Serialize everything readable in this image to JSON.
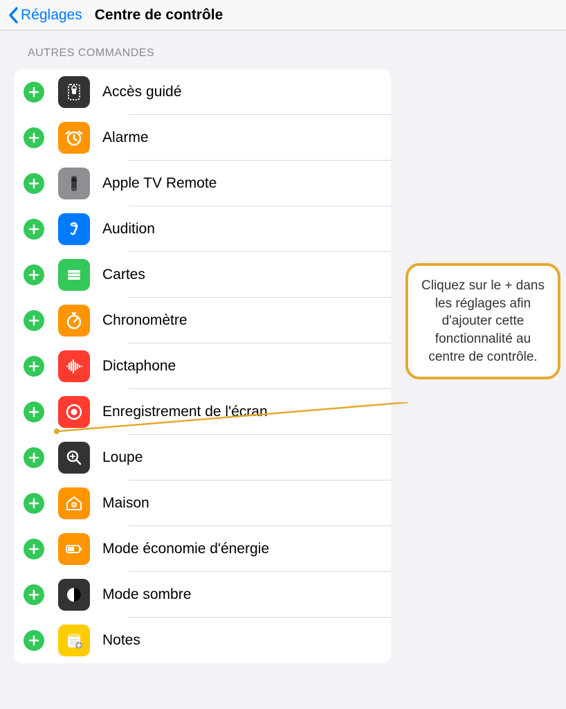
{
  "header": {
    "back_label": "Réglages",
    "title": "Centre de contrôle"
  },
  "section_header": "AUTRES COMMANDES",
  "callout_text": "Cliquez sur le + dans les réglages afin d'ajouter cette fonctionnalité au centre de contrôle.",
  "items": [
    {
      "id": "acces-guide",
      "label": "Accès guidé",
      "icon_bg": "#333333",
      "icon": "guided-access"
    },
    {
      "id": "alarme",
      "label": "Alarme",
      "icon_bg": "#ff9500",
      "icon": "alarm"
    },
    {
      "id": "apple-tv-remote",
      "label": "Apple TV Remote",
      "icon_bg": "#8e8e93",
      "icon": "remote"
    },
    {
      "id": "audition",
      "label": "Audition",
      "icon_bg": "#007aff",
      "icon": "ear"
    },
    {
      "id": "cartes",
      "label": "Cartes",
      "icon_bg": "#34c759",
      "icon": "wallet"
    },
    {
      "id": "chronometre",
      "label": "Chronomètre",
      "icon_bg": "#ff9500",
      "icon": "stopwatch"
    },
    {
      "id": "dictaphone",
      "label": "Dictaphone",
      "icon_bg": "#ff3b30",
      "icon": "waveform"
    },
    {
      "id": "enregistrement-ecran",
      "label": "Enregistrement de l'écran",
      "icon_bg": "#ff3b30",
      "icon": "record"
    },
    {
      "id": "loupe",
      "label": "Loupe",
      "icon_bg": "#333333",
      "icon": "magnifier"
    },
    {
      "id": "maison",
      "label": "Maison",
      "icon_bg": "#ff9500",
      "icon": "home"
    },
    {
      "id": "mode-economie",
      "label": "Mode économie d'énergie",
      "icon_bg": "#ff9500",
      "icon": "battery"
    },
    {
      "id": "mode-sombre",
      "label": "Mode sombre",
      "icon_bg": "#333333",
      "icon": "darkmode"
    },
    {
      "id": "notes",
      "label": "Notes",
      "icon_bg": "#ffcc00",
      "icon": "notes"
    }
  ]
}
